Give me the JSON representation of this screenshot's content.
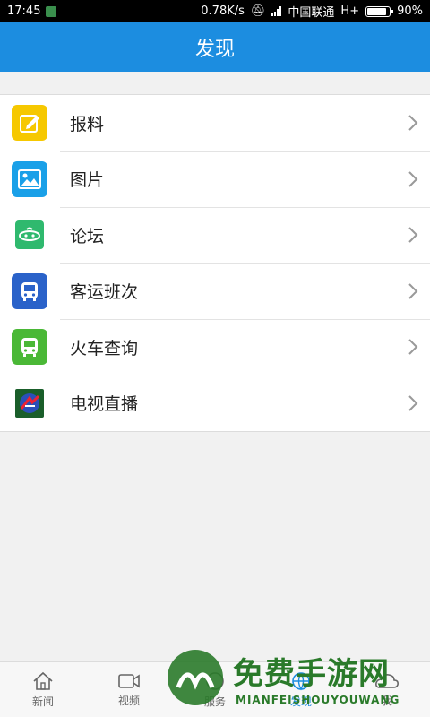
{
  "status_bar": {
    "time": "17:45",
    "speed": "0.78K/s",
    "carrier": "中国联通",
    "network": "H+",
    "battery_text": "90%",
    "battery_level": 0.9
  },
  "header": {
    "title": "发现"
  },
  "menu": [
    {
      "label": "报料",
      "icon": "edit-icon",
      "color": "#f6c800"
    },
    {
      "label": "图片",
      "icon": "image-icon",
      "color": "#1aa0e8"
    },
    {
      "label": "论坛",
      "icon": "forum-icon",
      "color": "#2fb96e"
    },
    {
      "label": "客运班次",
      "icon": "bus-icon",
      "color": "#2a62c9"
    },
    {
      "label": "火车查询",
      "icon": "train-icon",
      "color": "#4ab836"
    },
    {
      "label": "电视直播",
      "icon": "tv-live-icon",
      "color": "#1a5e2a"
    }
  ],
  "tabs": [
    {
      "label": "新闻",
      "icon": "home-icon"
    },
    {
      "label": "视频",
      "icon": "video-icon"
    },
    {
      "label": "服务",
      "icon": "service-icon"
    },
    {
      "label": "发现",
      "icon": "discover-icon",
      "active": true
    },
    {
      "label": "我",
      "icon": "profile-icon"
    }
  ],
  "watermark": {
    "title": "免费手游网",
    "subtitle": "MIANFEISHOUYOUWANG"
  }
}
